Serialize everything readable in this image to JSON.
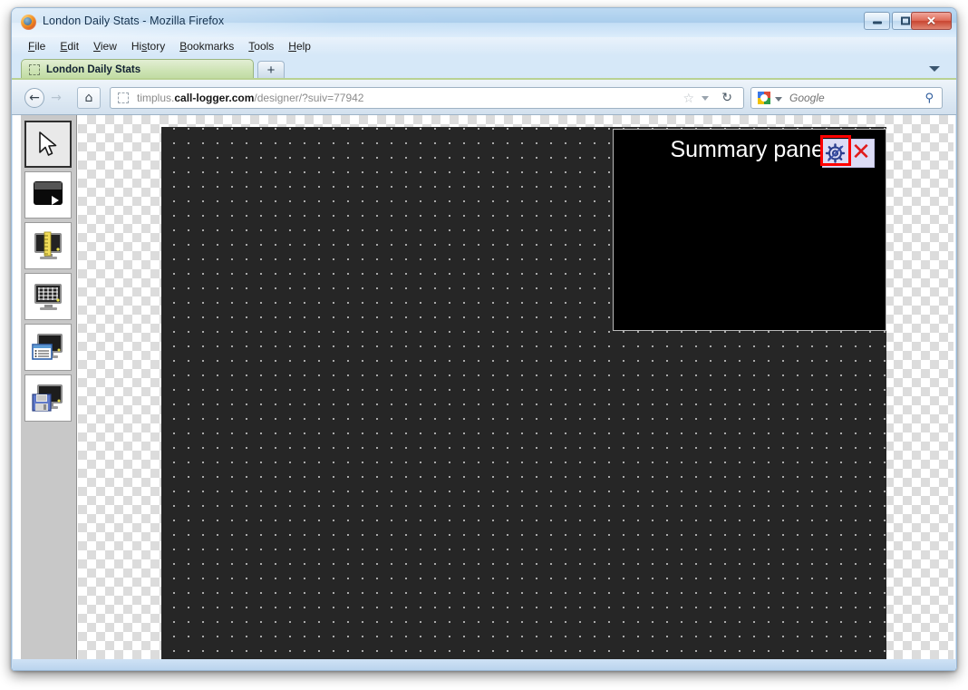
{
  "window": {
    "title": "London Daily Stats - Mozilla Firefox",
    "minimize_label": "–",
    "maximize_label": "□",
    "close_label": "✕"
  },
  "menubar": {
    "items": [
      {
        "accel": "F",
        "rest": "ile"
      },
      {
        "accel": "E",
        "rest": "dit"
      },
      {
        "accel": "V",
        "rest": "iew"
      },
      {
        "pre": "Hi",
        "accel": "s",
        "rest": "tory"
      },
      {
        "accel": "B",
        "rest": "ookmarks"
      },
      {
        "accel": "T",
        "rest": "ools"
      },
      {
        "accel": "H",
        "rest": "elp"
      }
    ]
  },
  "tabs": {
    "active_label": "London Daily Stats",
    "new_tab_label": "+"
  },
  "navigation": {
    "back_glyph": "←",
    "forward_glyph": "→",
    "home_glyph": "⌂",
    "url_prefix": "timplus.",
    "url_domain": "call-logger.com",
    "url_suffix": "/designer/?suiv=77942",
    "url_full": "timplus.call-logger.com/designer/?suiv=77942",
    "star_glyph": "☆",
    "reload_glyph": "↻"
  },
  "search": {
    "engine": "Google",
    "placeholder": "Google",
    "go_glyph": "⚲"
  },
  "toolbar": {
    "tools": [
      {
        "name": "select-tool",
        "icon": "cursor-icon",
        "selected": true
      },
      {
        "name": "preview-tool",
        "icon": "monitor-play-icon",
        "selected": false
      },
      {
        "name": "resize-tool",
        "icon": "monitor-ruler-icon",
        "selected": false
      },
      {
        "name": "grid-tool",
        "icon": "monitor-grid-icon",
        "selected": false
      },
      {
        "name": "panels-tool",
        "icon": "monitor-list-icon",
        "selected": false
      },
      {
        "name": "save-tool",
        "icon": "monitor-floppy-icon",
        "selected": false
      }
    ]
  },
  "canvas": {
    "widgets": [
      {
        "type": "summary-panel",
        "title": "Summary panel",
        "edit_icon": "gear-icon",
        "close_icon": "close-icon",
        "close_glyph": "✕",
        "highlighted": true,
        "highlight_color": "#ff0000"
      }
    ],
    "background_color": "#262626",
    "grid_dot_color": "#d6d6d6",
    "widget_background": "#000000"
  }
}
